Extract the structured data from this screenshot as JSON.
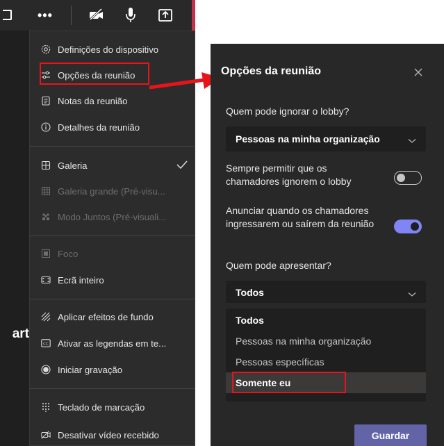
{
  "menu": {
    "items": [
      {
        "label": "Definições do dispositivo",
        "icon": "gear-icon",
        "disabled": false
      },
      {
        "label": "Opções da reunião",
        "icon": "sliders-icon",
        "disabled": false
      },
      {
        "label": "Notas da reunião",
        "icon": "notes-icon",
        "disabled": false
      },
      {
        "label": "Detalhes da reunião",
        "icon": "info-icon",
        "disabled": false
      },
      {
        "label": "Galeria",
        "icon": "gallery-icon",
        "disabled": false,
        "checked": true
      },
      {
        "label": "Galeria grande (Pré-visu...",
        "icon": "large-gallery-icon",
        "disabled": true
      },
      {
        "label": "Modo Juntos (Pré-visuali...",
        "icon": "together-mode-icon",
        "disabled": true
      },
      {
        "label": "Foco",
        "icon": "focus-icon",
        "disabled": true
      },
      {
        "label": "Ecrã inteiro",
        "icon": "fullscreen-icon",
        "disabled": false
      },
      {
        "label": "Aplicar efeitos de fundo",
        "icon": "background-effects-icon",
        "disabled": false
      },
      {
        "label": "Ativar as legendas em te...",
        "icon": "captions-icon",
        "disabled": false
      },
      {
        "label": "Iniciar gravação",
        "icon": "record-icon",
        "disabled": false
      },
      {
        "label": "Teclado de marcação",
        "icon": "dialpad-icon",
        "disabled": false
      },
      {
        "label": "Desativar vídeo recebido",
        "icon": "video-off-icon",
        "disabled": false
      }
    ],
    "background_text": "art"
  },
  "panel": {
    "title": "Opções da reunião",
    "lobby_question": "Quem pode ignorar o lobby?",
    "lobby_value": "Pessoas na minha organização",
    "callers_bypass_label": "Sempre permitir que os chamadores ignorem o lobby",
    "callers_bypass_on": false,
    "announce_label": "Anunciar quando os chamadores ingressarem ou saírem da reunião",
    "announce_on": true,
    "present_question": "Quem pode apresentar?",
    "present_value": "Todos",
    "present_options": [
      "Todos",
      "Pessoas na minha organização",
      "Pessoas específicas",
      "Somente eu"
    ],
    "save_label": "Guardar"
  },
  "colors": {
    "accent": "#6264a7",
    "toggle_on": "#7f85f5",
    "highlight": "#e8141c"
  }
}
